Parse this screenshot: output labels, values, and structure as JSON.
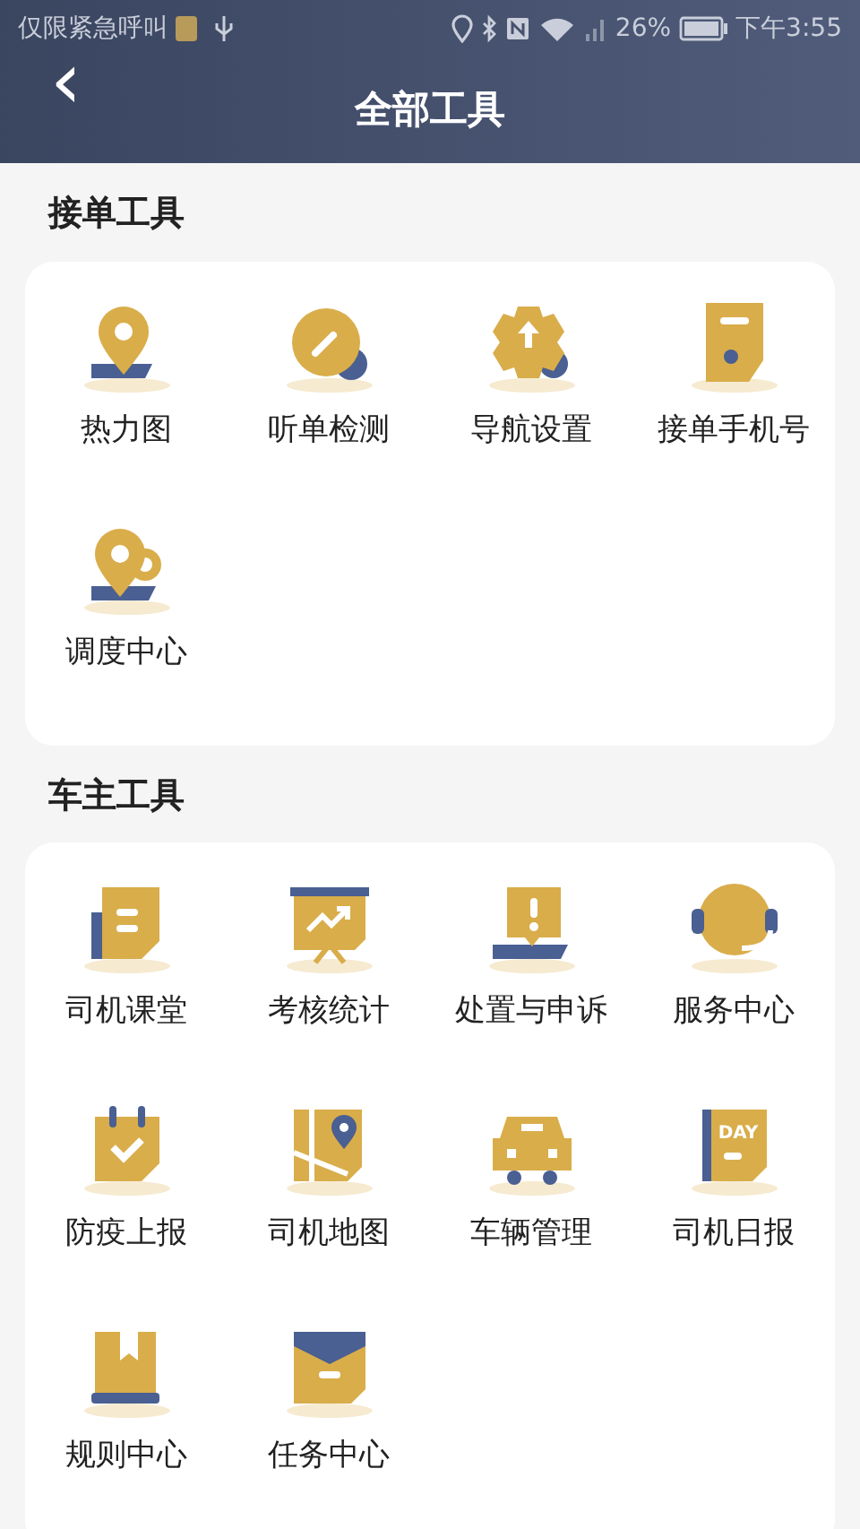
{
  "status_bar": {
    "carrier": "仅限紧急呼叫",
    "battery": "26%",
    "time": "下午3:55"
  },
  "header": {
    "back": "‹",
    "title": "全部工具"
  },
  "sections": [
    {
      "title": "接单工具",
      "tools": [
        {
          "label": "热力图",
          "kind": "pin"
        },
        {
          "label": "听单检测",
          "kind": "gauge"
        },
        {
          "label": "导航设置",
          "kind": "gear"
        },
        {
          "label": "接单手机号",
          "kind": "phone"
        },
        {
          "label": "调度中心",
          "kind": "pins"
        }
      ]
    },
    {
      "title": "车主工具",
      "tools": [
        {
          "label": "司机课堂",
          "kind": "doc"
        },
        {
          "label": "考核统计",
          "kind": "board"
        },
        {
          "label": "处置与申诉",
          "kind": "alert"
        },
        {
          "label": "服务中心",
          "kind": "headset"
        },
        {
          "label": "防疫上报",
          "kind": "calendar"
        },
        {
          "label": "司机地图",
          "kind": "map"
        },
        {
          "label": "车辆管理",
          "kind": "car"
        },
        {
          "label": "司机日报",
          "kind": "daybook",
          "icon_text": "DAY"
        },
        {
          "label": "规则中心",
          "kind": "book"
        },
        {
          "label": "任务中心",
          "kind": "folder"
        }
      ]
    }
  ]
}
